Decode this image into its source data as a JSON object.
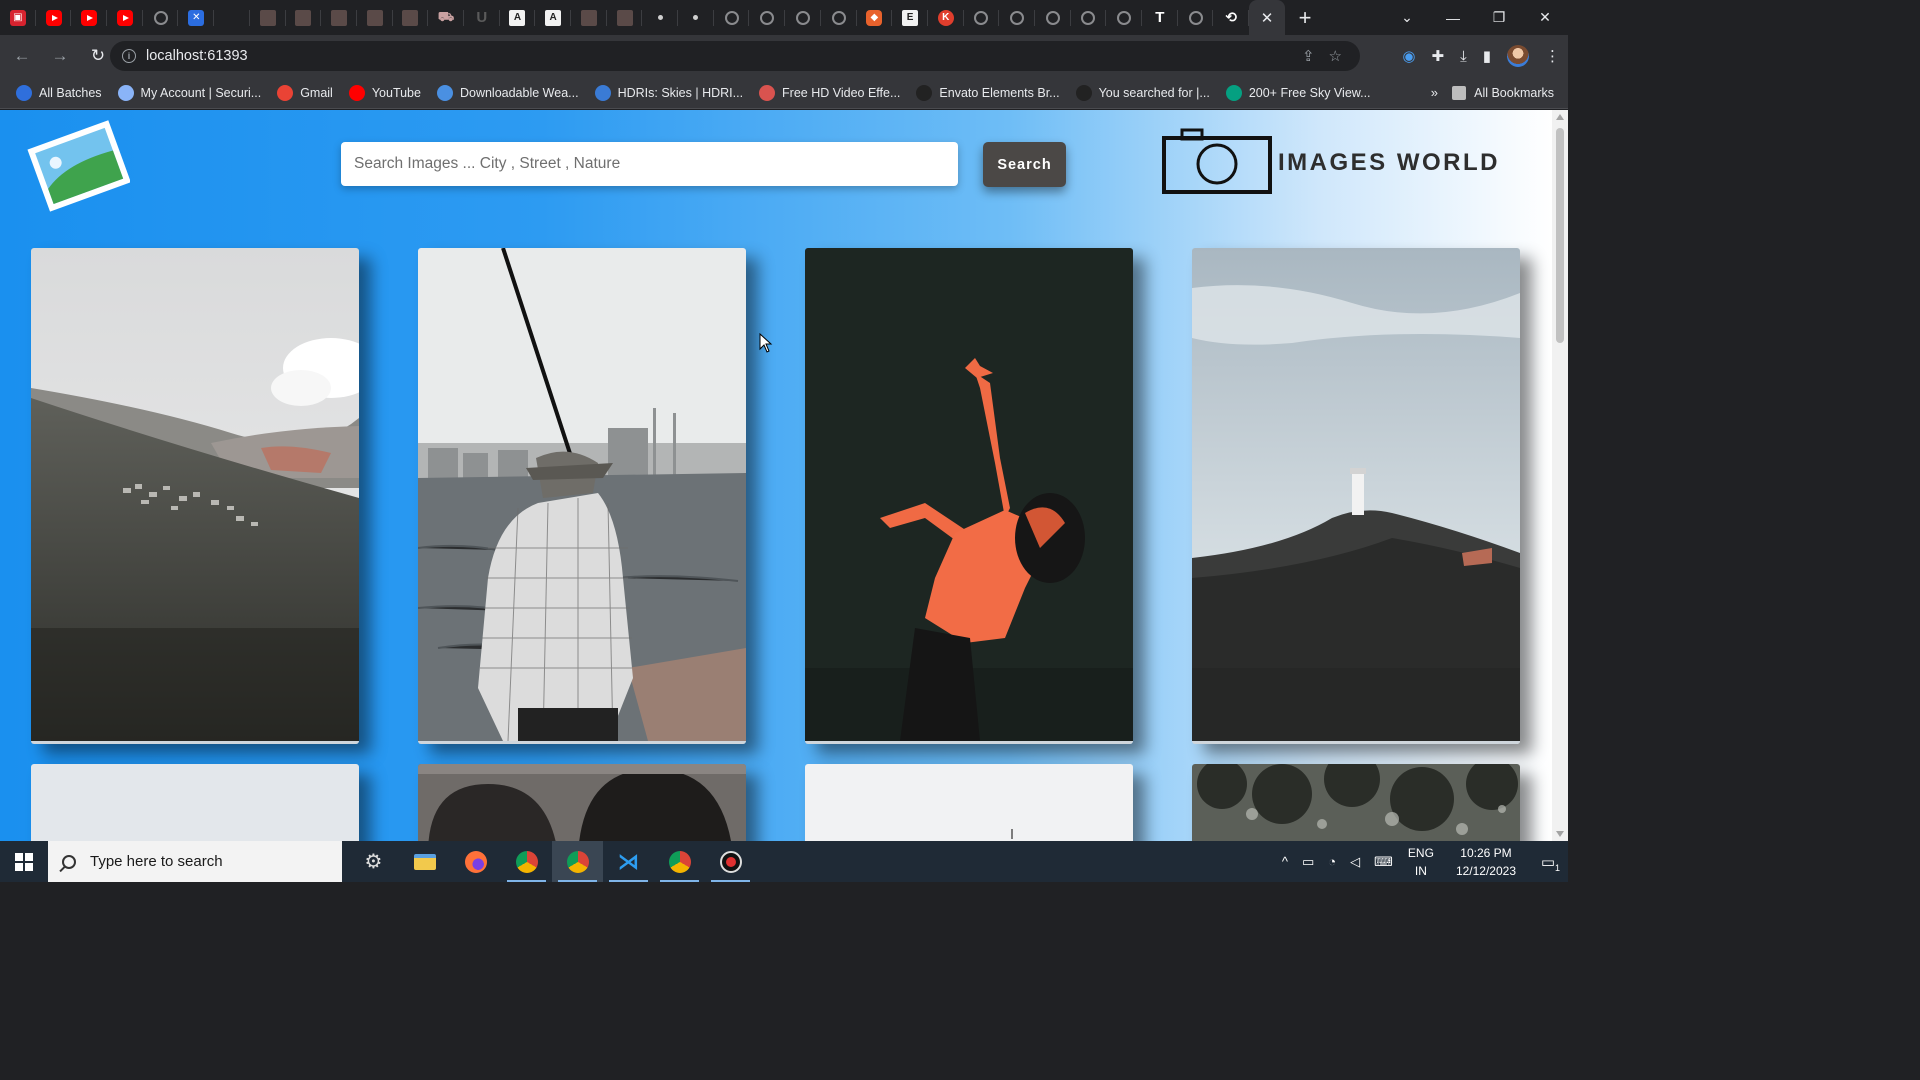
{
  "browser": {
    "url": "localhost:61393",
    "tabs_favicons": [
      "bag-icon",
      "youtube-icon",
      "youtube-icon",
      "youtube-icon",
      "github-icon",
      "figma-icon",
      "blank",
      "doc-icon",
      "doc-icon",
      "doc-icon",
      "doc-icon",
      "doc-icon",
      "cart-icon",
      "u-icon",
      "A",
      "A",
      "doc-icon",
      "doc-icon",
      "dot-icon",
      "dot-icon",
      "globe-icon",
      "globe-icon",
      "globe-icon",
      "globe-icon",
      "tag-icon",
      "E",
      "k-icon",
      "globe-icon",
      "globe-icon",
      "globe-icon",
      "globe-icon",
      "globe-icon",
      "T",
      "globe-icon",
      "history-icon"
    ],
    "bookmarks": [
      {
        "label": "All Batches",
        "color": "#2f6fdc"
      },
      {
        "label": "My Account | Securi...",
        "color": "#8ab4f8"
      },
      {
        "label": "Gmail",
        "color": "#ea4335"
      },
      {
        "label": "YouTube",
        "color": "#ff0000"
      },
      {
        "label": "Downloadable Wea...",
        "color": "#4a90e2"
      },
      {
        "label": "HDRIs: Skies | HDRI...",
        "color": "#3a7bd5"
      },
      {
        "label": "Free HD Video Effe...",
        "color": "#d9534f"
      },
      {
        "label": "Envato Elements Br...",
        "color": "#222222"
      },
      {
        "label": "You searched for |...",
        "color": "#222222"
      },
      {
        "label": "200+ Free Sky View...",
        "color": "#05a081"
      }
    ],
    "bookmarks_more": "»",
    "all_bookmarks": "All Bookmarks"
  },
  "site": {
    "search_placeholder": "Search Images ... City , Street , Nature",
    "search_button": "Search",
    "brand": "IMAGES WORLD"
  },
  "gallery": [
    {
      "name": "mountain-village-photo",
      "alt": "mountain village"
    },
    {
      "name": "fisherman-photo",
      "alt": "fisherman"
    },
    {
      "name": "dancer-photo",
      "alt": "dancer"
    },
    {
      "name": "lighthouse-photo",
      "alt": "lighthouse"
    },
    {
      "name": "sky-photo",
      "alt": "sky"
    },
    {
      "name": "arches-photo",
      "alt": "arches"
    },
    {
      "name": "white-photo",
      "alt": "white"
    },
    {
      "name": "trees-photo",
      "alt": "trees"
    }
  ],
  "taskbar": {
    "search_placeholder": "Type here to search",
    "lang_line1": "ENG",
    "lang_line2": "IN",
    "time": "10:26 PM",
    "date": "12/12/2023",
    "notification_count": "1"
  }
}
